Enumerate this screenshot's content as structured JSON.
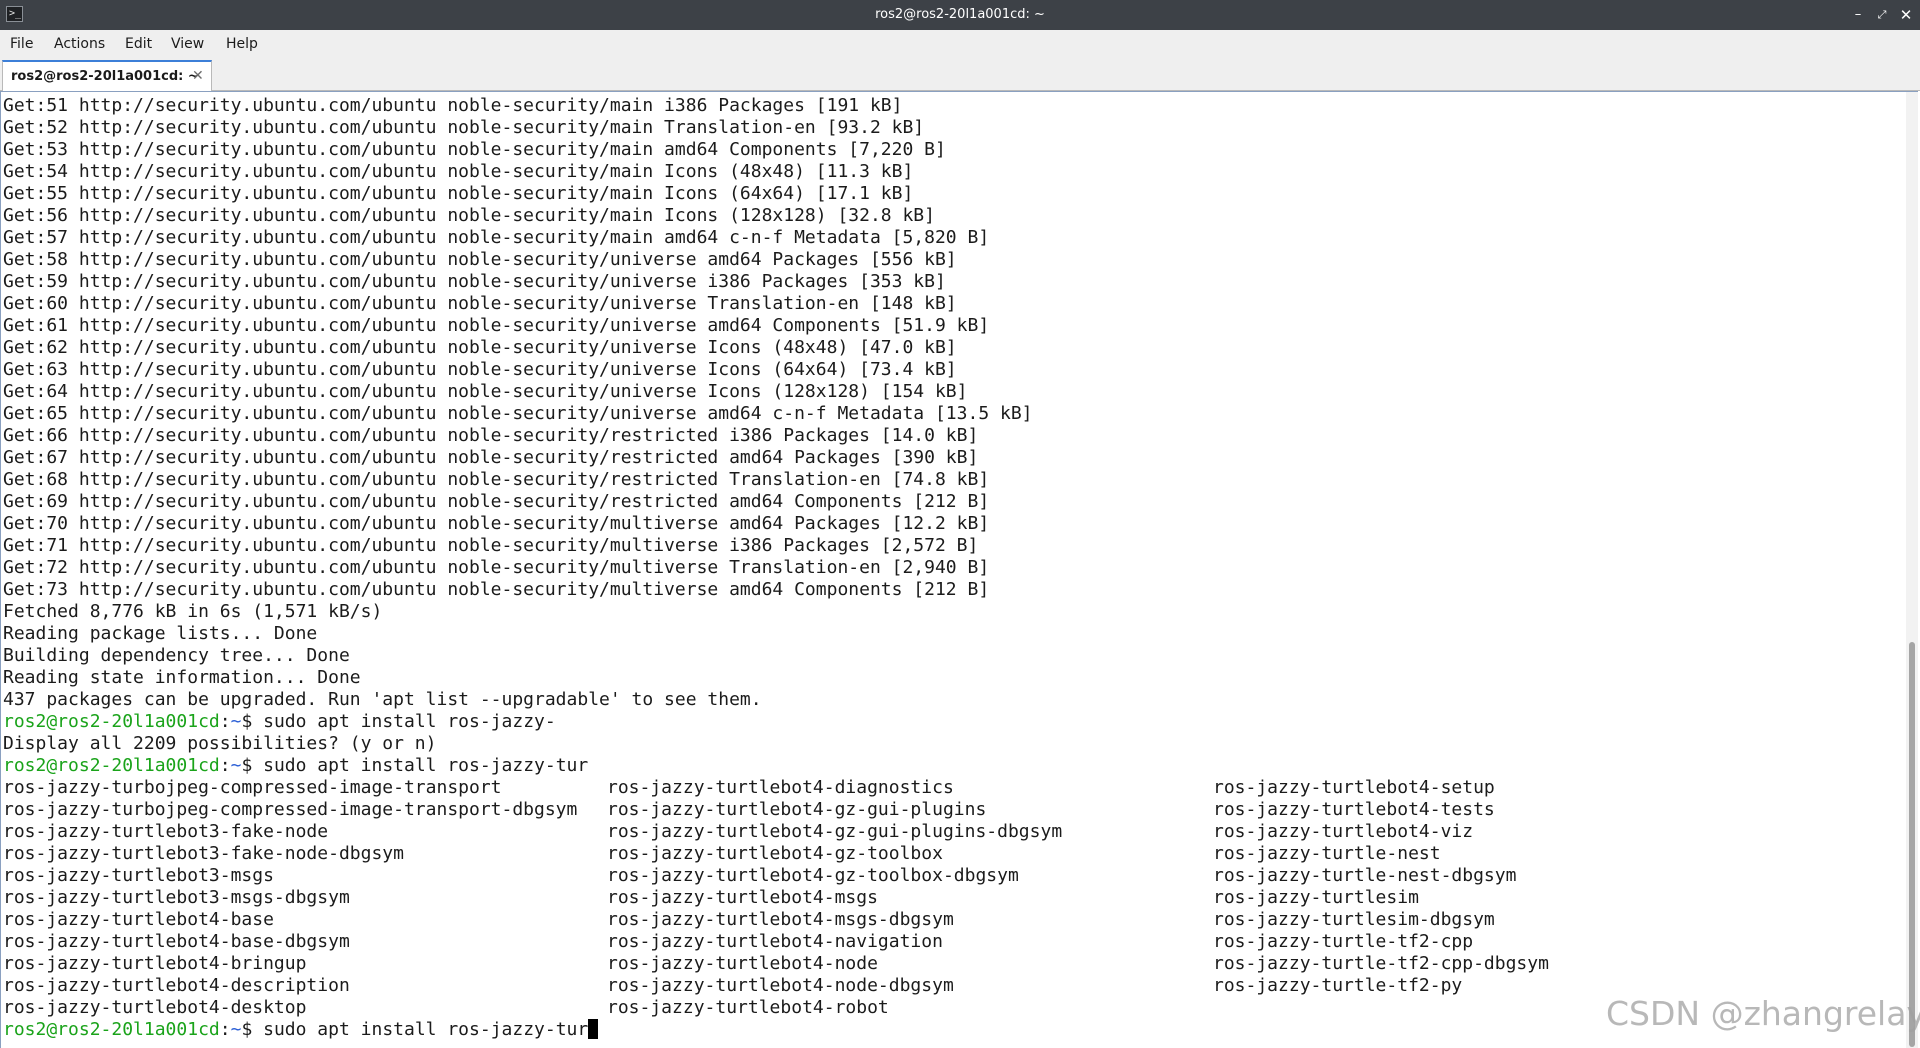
{
  "window": {
    "title": "ros2@ros2-20l1a001cd: ~",
    "icon": "terminal-icon",
    "icon_glyph": ">_",
    "controls": {
      "minimize": "–",
      "maximize": "⤢",
      "close": "✕"
    }
  },
  "menubar": {
    "items": [
      "File",
      "Actions",
      "Edit",
      "View",
      "Help"
    ]
  },
  "tab": {
    "label": "ros2@ros2-20l1a001cd: ~",
    "close_glyph": "✕"
  },
  "terminal": {
    "output_lines": [
      "Get:51 http://security.ubuntu.com/ubuntu noble-security/main i386 Packages [191 kB]",
      "Get:52 http://security.ubuntu.com/ubuntu noble-security/main Translation-en [93.2 kB]",
      "Get:53 http://security.ubuntu.com/ubuntu noble-security/main amd64 Components [7,220 B]",
      "Get:54 http://security.ubuntu.com/ubuntu noble-security/main Icons (48x48) [11.3 kB]",
      "Get:55 http://security.ubuntu.com/ubuntu noble-security/main Icons (64x64) [17.1 kB]",
      "Get:56 http://security.ubuntu.com/ubuntu noble-security/main Icons (128x128) [32.8 kB]",
      "Get:57 http://security.ubuntu.com/ubuntu noble-security/main amd64 c-n-f Metadata [5,820 B]",
      "Get:58 http://security.ubuntu.com/ubuntu noble-security/universe amd64 Packages [556 kB]",
      "Get:59 http://security.ubuntu.com/ubuntu noble-security/universe i386 Packages [353 kB]",
      "Get:60 http://security.ubuntu.com/ubuntu noble-security/universe Translation-en [148 kB]",
      "Get:61 http://security.ubuntu.com/ubuntu noble-security/universe amd64 Components [51.9 kB]",
      "Get:62 http://security.ubuntu.com/ubuntu noble-security/universe Icons (48x48) [47.0 kB]",
      "Get:63 http://security.ubuntu.com/ubuntu noble-security/universe Icons (64x64) [73.4 kB]",
      "Get:64 http://security.ubuntu.com/ubuntu noble-security/universe Icons (128x128) [154 kB]",
      "Get:65 http://security.ubuntu.com/ubuntu noble-security/universe amd64 c-n-f Metadata [13.5 kB]",
      "Get:66 http://security.ubuntu.com/ubuntu noble-security/restricted i386 Packages [14.0 kB]",
      "Get:67 http://security.ubuntu.com/ubuntu noble-security/restricted amd64 Packages [390 kB]",
      "Get:68 http://security.ubuntu.com/ubuntu noble-security/restricted Translation-en [74.8 kB]",
      "Get:69 http://security.ubuntu.com/ubuntu noble-security/restricted amd64 Components [212 B]",
      "Get:70 http://security.ubuntu.com/ubuntu noble-security/multiverse amd64 Packages [12.2 kB]",
      "Get:71 http://security.ubuntu.com/ubuntu noble-security/multiverse i386 Packages [2,572 B]",
      "Get:72 http://security.ubuntu.com/ubuntu noble-security/multiverse Translation-en [2,940 B]",
      "Get:73 http://security.ubuntu.com/ubuntu noble-security/multiverse amd64 Components [212 B]",
      "Fetched 8,776 kB in 6s (1,571 kB/s)",
      "Reading package lists... Done",
      "Building dependency tree... Done",
      "Reading state information... Done",
      "437 packages can be upgraded. Run 'apt list --upgradable' to see them."
    ],
    "prompt": {
      "user_host": "ros2@ros2-20l1a001cd",
      "colon": ":",
      "dir": "~",
      "dollar": "$"
    },
    "cmd1": " sudo apt install ros-jazzy-",
    "cmd1_response": "Display all 2209 possibilities? (y or n)",
    "cmd2": " sudo apt install ros-jazzy-tur",
    "completions": [
      [
        "ros-jazzy-turbojpeg-compressed-image-transport",
        "ros-jazzy-turtlebot4-diagnostics",
        "ros-jazzy-turtlebot4-setup"
      ],
      [
        "ros-jazzy-turbojpeg-compressed-image-transport-dbgsym",
        "ros-jazzy-turtlebot4-gz-gui-plugins",
        "ros-jazzy-turtlebot4-tests"
      ],
      [
        "ros-jazzy-turtlebot3-fake-node",
        "ros-jazzy-turtlebot4-gz-gui-plugins-dbgsym",
        "ros-jazzy-turtlebot4-viz"
      ],
      [
        "ros-jazzy-turtlebot3-fake-node-dbgsym",
        "ros-jazzy-turtlebot4-gz-toolbox",
        "ros-jazzy-turtle-nest"
      ],
      [
        "ros-jazzy-turtlebot3-msgs",
        "ros-jazzy-turtlebot4-gz-toolbox-dbgsym",
        "ros-jazzy-turtle-nest-dbgsym"
      ],
      [
        "ros-jazzy-turtlebot3-msgs-dbgsym",
        "ros-jazzy-turtlebot4-msgs",
        "ros-jazzy-turtlesim"
      ],
      [
        "ros-jazzy-turtlebot4-base",
        "ros-jazzy-turtlebot4-msgs-dbgsym",
        "ros-jazzy-turtlesim-dbgsym"
      ],
      [
        "ros-jazzy-turtlebot4-base-dbgsym",
        "ros-jazzy-turtlebot4-navigation",
        "ros-jazzy-turtle-tf2-cpp"
      ],
      [
        "ros-jazzy-turtlebot4-bringup",
        "ros-jazzy-turtlebot4-node",
        "ros-jazzy-turtle-tf2-cpp-dbgsym"
      ],
      [
        "ros-jazzy-turtlebot4-description",
        "ros-jazzy-turtlebot4-node-dbgsym",
        "ros-jazzy-turtle-tf2-py"
      ],
      [
        "ros-jazzy-turtlebot4-desktop",
        "ros-jazzy-turtlebot4-robot",
        ""
      ]
    ],
    "cmd3": " sudo apt install ros-jazzy-tur",
    "colors": {
      "user_host": "#1aa31a",
      "dir": "#2b5fd6",
      "text": "#1b1b1b"
    }
  },
  "scrollbar": {
    "position_fraction": 1.0
  },
  "watermark": "CSDN @zhangrelay"
}
